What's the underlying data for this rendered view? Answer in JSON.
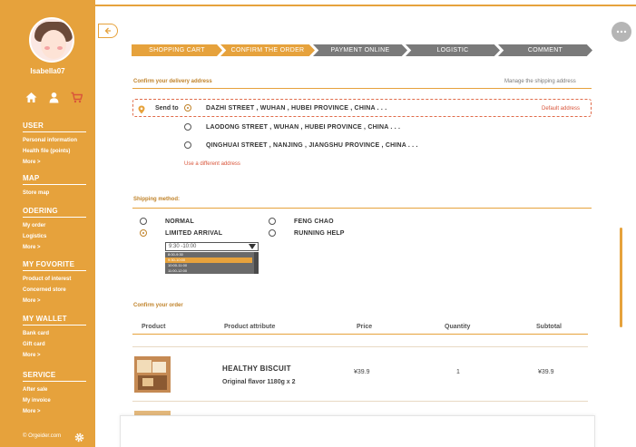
{
  "user": {
    "name": "Isabella07"
  },
  "sidebar": {
    "sections": [
      {
        "title": "USER",
        "items": [
          "Personal information",
          "Health file (points)",
          "More >"
        ]
      },
      {
        "title": "MAP",
        "items": [
          "Store map"
        ]
      },
      {
        "title": "ODERING",
        "items": [
          "My order",
          "Logistics",
          "More >"
        ]
      },
      {
        "title": "MY FOVORITE",
        "items": [
          "Product of interest",
          "Concerned store",
          "More >"
        ]
      },
      {
        "title": "MY WALLET",
        "items": [
          "Bank card",
          "Gift card",
          "More >"
        ]
      },
      {
        "title": "SERVICE",
        "items": [
          "After sale",
          "My invoice",
          "More >"
        ]
      }
    ],
    "footer": "© Orgeider.com"
  },
  "steps": [
    {
      "label": "SHOPPING CART",
      "active": true
    },
    {
      "label": "CONFIRM THE ORDER",
      "active": true
    },
    {
      "label": "PAYMENT ONLINE",
      "active": false
    },
    {
      "label": "LOGISTIC",
      "active": false
    },
    {
      "label": "COMMENT",
      "active": false
    }
  ],
  "address": {
    "title": "Confirm your delivery address",
    "manage_link": "Manage the shipping address",
    "send_to": "Send to",
    "default_label": "Default address",
    "options": [
      "DAZHI STREET , WUHAN , HUBEI PROVINCE , CHINA . . .",
      "LAODONG STREET , WUHAN , HUBEI PROVINCE , CHINA . . .",
      "QINGHUAI STREET , NANJING , JIANGSHU PROVINCE , CHINA . . ."
    ],
    "selected_index": 0,
    "different_link": "Use a different address"
  },
  "shipping": {
    "title": "Shipping method:",
    "options": [
      "NORMAL",
      "FENG CHAO",
      "LIMITED ARRIVAL",
      "RUNNING HELP"
    ],
    "selected": "LIMITED ARRIVAL",
    "time_selected": "9:30 -10:00",
    "time_options": [
      "8:00-9:30",
      "9:30-10:00",
      "10:00-11:00",
      "11:00-12:00"
    ],
    "time_highlighted": "9:30-10:00"
  },
  "order": {
    "title": "Confirm your order",
    "columns": [
      "Product",
      "Product attribute",
      "Price",
      "Quantity",
      "Subtotal"
    ],
    "rows": [
      {
        "name": "HEALTHY  BISCUIT",
        "attribute": "Original flavor 1180g x 2",
        "price": "¥39.9",
        "quantity": "1",
        "subtotal": "¥39.9"
      }
    ]
  },
  "colors": {
    "accent": "#e6a23c",
    "link": "#d9553a",
    "step_inactive": "#7a7a7a"
  },
  "icons": [
    "home-icon",
    "user-icon",
    "cart-icon",
    "back-arrow-icon",
    "more-icon",
    "location-pin-icon",
    "gear-icon"
  ]
}
